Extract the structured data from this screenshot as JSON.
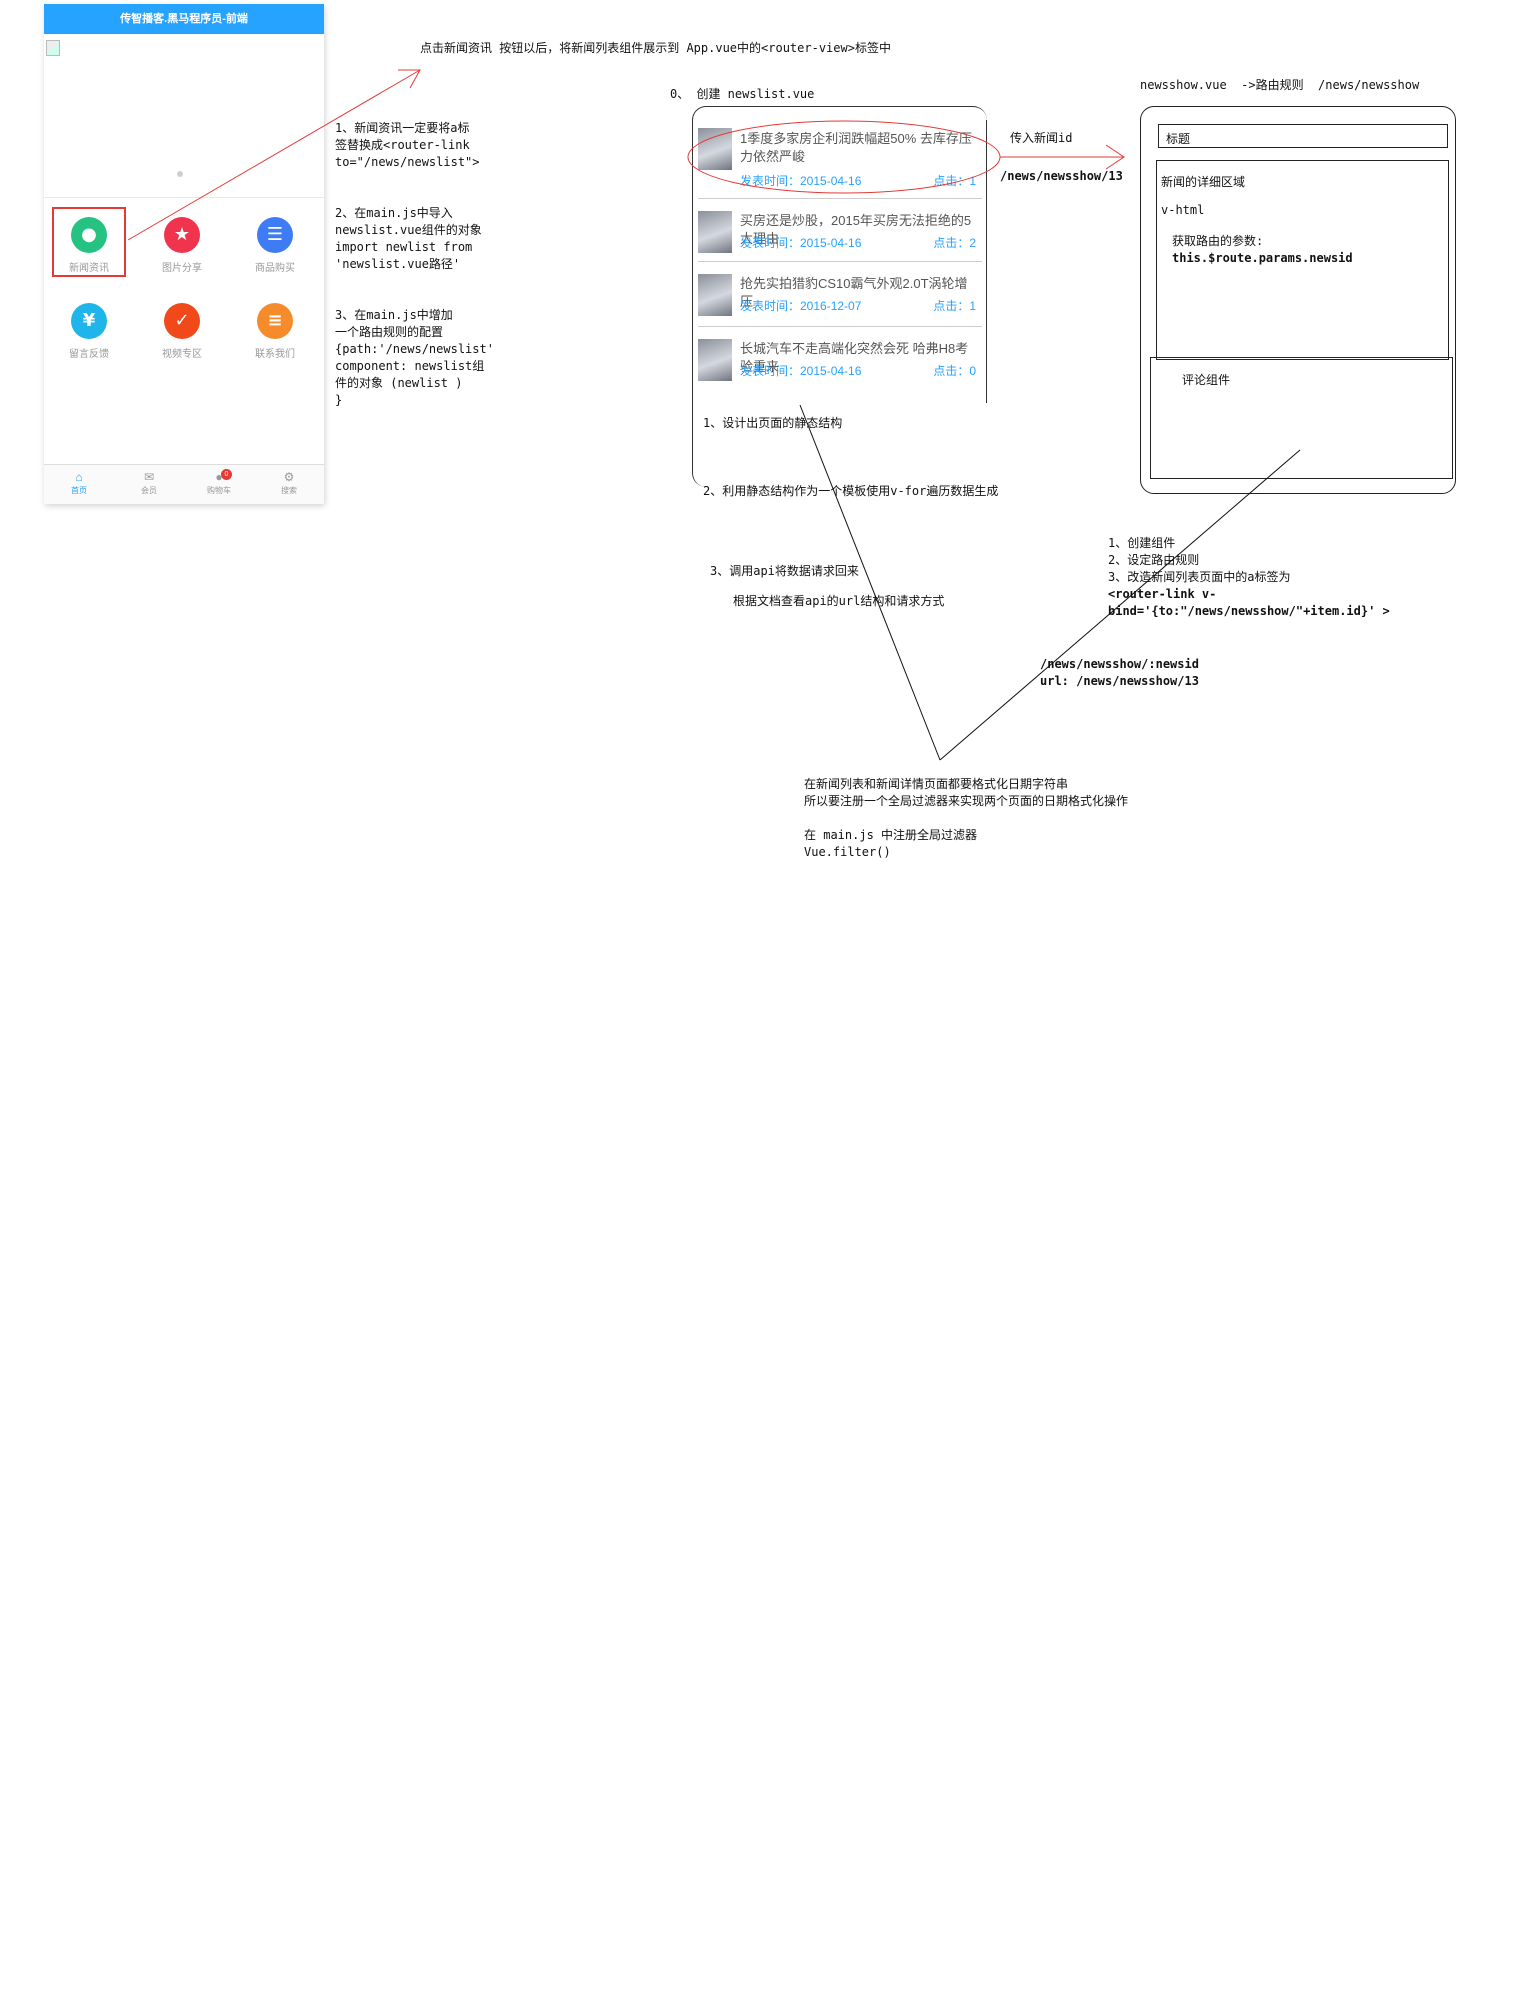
{
  "phone": {
    "header_title": "传智播客.黑马程序员-前端",
    "grid": [
      {
        "label": "新闻资讯",
        "icon": "location-pin-icon",
        "color": "#26c281"
      },
      {
        "label": "图片分享",
        "icon": "photo-share-icon",
        "color": "#f0344d"
      },
      {
        "label": "商品购买",
        "icon": "shopping-cart-icon",
        "color": "#3d7cf5"
      },
      {
        "label": "留言反馈",
        "icon": "yen-feedback-icon",
        "color": "#1fb5ea"
      },
      {
        "label": "视频专区",
        "icon": "video-check-icon",
        "color": "#f2491a"
      },
      {
        "label": "联系我们",
        "icon": "contact-list-icon",
        "color": "#f68b2b"
      }
    ],
    "tabs": [
      {
        "label": "首页",
        "icon": "home-icon"
      },
      {
        "label": "会员",
        "icon": "mail-icon"
      },
      {
        "label": "购物车",
        "icon": "cart-icon"
      },
      {
        "label": "搜索",
        "icon": "settings-icon"
      }
    ],
    "cart_badge": "0"
  },
  "notes": {
    "top_arrow": "点击新闻资讯 按钮以后，将新闻列表组件展示到 App.vue中的<router-view>标签中",
    "step1": "1、新闻资讯一定要将a标\n签替换成<router-link\nto=\"/news/newslist\">",
    "step2": "2、在main.js中导入\nnewslist.vue组件的对象\nimport newlist from\n'newslist.vue路径'",
    "step3": "3、在main.js中增加\n一个路由规则的配置\n{path:'/news/newslist'\ncomponent: newslist组\n件的对象 (newlist )\n}",
    "create_newslist": "0、 创建 newslist.vue",
    "pass_id": "传入新闻id",
    "route_example": "/news/newsshow/13",
    "newsshow_header": "newsshow.vue  ->路由规则  /news/newsshow",
    "nl_step1": "1、设计出页面的静态结构",
    "nl_step2": "2、利用静态结构作为一个模板使用v-for遍历数据生成",
    "nl_step3": "3、调用api将数据请求回来",
    "nl_step3b": "根据文档查看api的url结构和请求方式",
    "ns_steps": "1、创建组件\n2、设定路由规则\n3、改造新闻列表页面中的a标签为",
    "ns_routerlink": "<router-link v-\nbind='{to:\"/news/newsshow/\"+item.id}' >",
    "route_param": "/news/newsshow/:newsid\nurl: /news/newsshow/13",
    "filter_note": "在新闻列表和新闻详情页面都要格式化日期字符串\n所以要注册一个全局过滤器来实现两个页面的日期格式化操作\n\n在 main.js 中注册全局过滤器\nVue.filter()"
  },
  "newslist": {
    "items": [
      {
        "title": "1季度多家房企利润跌幅超50% 去库存压力依然严峻",
        "date_label": "发表时间：2015-04-16",
        "clicks_label": "点击：1"
      },
      {
        "title": "买房还是炒股，2015年买房无法拒绝的5大理由",
        "date_label": "发表时间：2015-04-16",
        "clicks_label": "点击：2"
      },
      {
        "title": "抢先实拍猎豹CS10霸气外观2.0T涡轮增压",
        "date_label": "发表时间：2016-12-07",
        "clicks_label": "点击：1"
      },
      {
        "title": "长城汽车不走高端化突然会死 哈弗H8考验重来",
        "date_label": "发表时间：2015-04-16",
        "clicks_label": "点击：0"
      }
    ]
  },
  "newsshow": {
    "title_label": "标题",
    "detail_label": "新闻的详细区域",
    "vhtml_label": "v-html",
    "params_label": "获取路由的参数:",
    "params_code": "this.$route.params.newsid",
    "comment_label": "评论组件"
  }
}
